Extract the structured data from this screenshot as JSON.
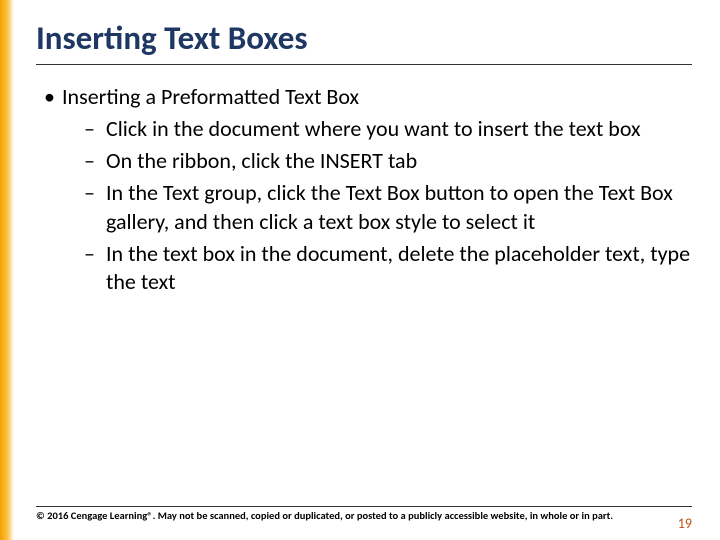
{
  "title": "Inserting Text Boxes",
  "bullets": {
    "l1_0": "Inserting a Preformatted Text Box",
    "l2_0": "Click in the document where you want to insert the text box",
    "l2_1": "On the ribbon, click the INSERT tab",
    "l2_2": "In the Text group, click the Text Box button to open the Text Box gallery, and then click a text box style to select it",
    "l2_3": "In the text box in the document, delete the placeholder text, type the text"
  },
  "footer": {
    "copyright": "© 2016 Cengage Learning®. May not be scanned, copied or duplicated, or posted to a publicly accessible website, in whole or in part.",
    "page": "19"
  },
  "colors": {
    "title": "#1f3763",
    "accent": "#f5a000",
    "pagenum": "#c05010"
  }
}
